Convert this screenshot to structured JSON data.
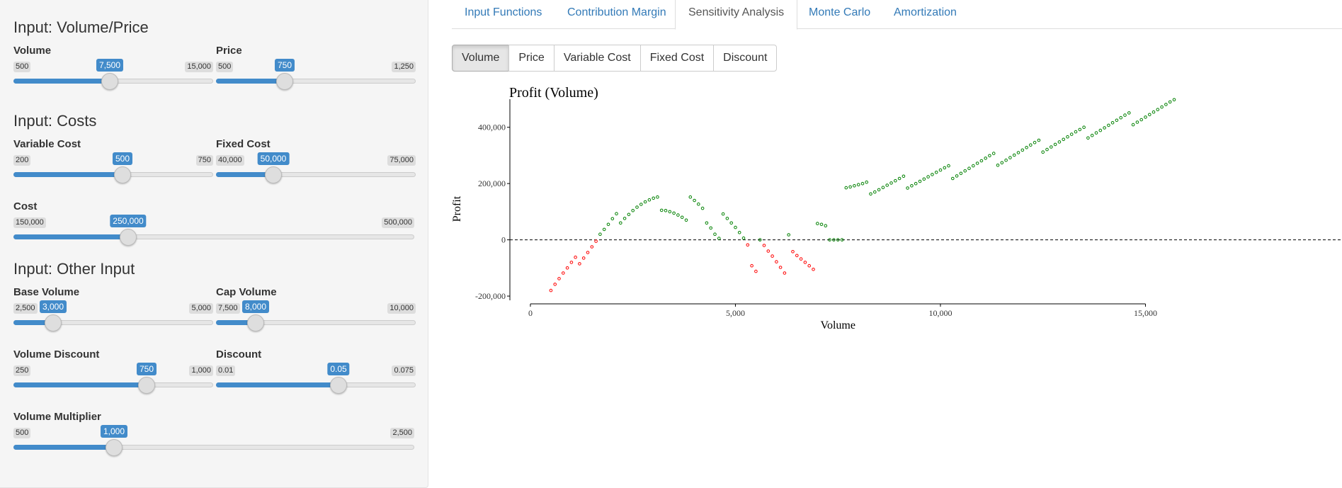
{
  "sidebar": {
    "sections": [
      {
        "title": "Input: Volume/Price"
      },
      {
        "title": "Input: Costs"
      },
      {
        "title": "Input: Other Input"
      }
    ],
    "sliders": {
      "volume": {
        "label": "Volume",
        "min": "500",
        "max": "15,000",
        "value": "7,500",
        "fraction": 0.483
      },
      "price": {
        "label": "Price",
        "min": "500",
        "max": "1,250",
        "value": "750",
        "fraction": 0.345
      },
      "variable_cost": {
        "label": "Variable Cost",
        "min": "200",
        "max": "750",
        "value": "500",
        "fraction": 0.545
      },
      "fixed_cost": {
        "label": "Fixed Cost",
        "min": "40,000",
        "max": "75,000",
        "value": "50,000",
        "fraction": 0.286
      },
      "cost": {
        "label": "Cost",
        "min": "150,000",
        "max": "500,000",
        "value": "250,000",
        "fraction": 0.286
      },
      "base_volume": {
        "label": "Base Volume",
        "min": "2,500",
        "max": "5,000",
        "value": "3,000",
        "fraction": 0.2
      },
      "cap_volume": {
        "label": "Cap Volume",
        "min": "7,500",
        "max": "10,000",
        "value": "8,000",
        "fraction": 0.2
      },
      "volume_discount": {
        "label": "Volume Discount",
        "min": "250",
        "max": "1,000",
        "value": "750",
        "fraction": 0.667
      },
      "discount": {
        "label": "Discount",
        "min": "0.01",
        "max": "0.075",
        "value": "0.05",
        "fraction": 0.615
      },
      "volume_multiplier": {
        "label": "Volume Multiplier",
        "min": "500",
        "max": "2,500",
        "value": "1,000",
        "fraction": 0.25
      }
    }
  },
  "tabs": [
    {
      "label": "Input Functions",
      "active": false
    },
    {
      "label": "Contribution Margin",
      "active": false
    },
    {
      "label": "Sensitivity Analysis",
      "active": true
    },
    {
      "label": "Monte Carlo",
      "active": false
    },
    {
      "label": "Amortization",
      "active": false
    }
  ],
  "buttons": [
    {
      "label": "Volume",
      "active": true
    },
    {
      "label": "Price",
      "active": false
    },
    {
      "label": "Variable Cost",
      "active": false
    },
    {
      "label": "Fixed Cost",
      "active": false
    },
    {
      "label": "Discount",
      "active": false
    }
  ],
  "colors": {
    "accent": "#428bca",
    "positive": "#008000",
    "negative": "#ff0000",
    "link": "#337ab7"
  },
  "chart_data": {
    "type": "scatter",
    "title": "Profit (Volume)",
    "xlabel": "Volume",
    "ylabel": "Profit",
    "xlim": [
      0,
      15000
    ],
    "ylim": [
      -200000,
      500000
    ],
    "x_ticks": [
      0,
      5000,
      10000,
      15000
    ],
    "x_tick_labels": [
      "0",
      "5,000",
      "10,000",
      "15,000"
    ],
    "y_ticks": [
      -200000,
      0,
      200000,
      400000
    ],
    "y_tick_labels": [
      "-200,000",
      "0",
      "200,000",
      "400,000"
    ],
    "reference_line": {
      "y": 0,
      "style": "dashed"
    },
    "color_rule": "green when profit >= 0, red when profit < 0",
    "series": [
      {
        "points": [
          [
            500,
            -180000
          ],
          [
            600,
            -158000
          ],
          [
            700,
            -138000
          ],
          [
            800,
            -118000
          ],
          [
            900,
            -100000
          ],
          [
            1000,
            -80000
          ],
          [
            1100,
            -62000
          ],
          [
            1200,
            -85000
          ],
          [
            1300,
            -65000
          ],
          [
            1400,
            -45000
          ],
          [
            1500,
            -25000
          ],
          [
            1600,
            -5000
          ],
          [
            1700,
            20000
          ],
          [
            1800,
            37000
          ],
          [
            1900,
            55000
          ],
          [
            2000,
            75000
          ],
          [
            2100,
            93000
          ],
          [
            2200,
            60000
          ],
          [
            2300,
            76000
          ],
          [
            2400,
            90000
          ],
          [
            2500,
            104000
          ],
          [
            2600,
            116000
          ],
          [
            2700,
            126000
          ],
          [
            2800,
            135000
          ],
          [
            2900,
            142000
          ],
          [
            3000,
            148000
          ],
          [
            3100,
            152000
          ],
          [
            3200,
            105000
          ],
          [
            3300,
            104000
          ],
          [
            3400,
            100000
          ],
          [
            3500,
            95000
          ],
          [
            3600,
            88000
          ],
          [
            3700,
            80000
          ],
          [
            3800,
            70000
          ],
          [
            3900,
            152000
          ],
          [
            4000,
            140000
          ],
          [
            4100,
            127000
          ],
          [
            4200,
            112000
          ],
          [
            4300,
            60000
          ],
          [
            4400,
            42000
          ],
          [
            4500,
            20000
          ],
          [
            4600,
            5000
          ],
          [
            4700,
            92000
          ],
          [
            4800,
            76000
          ],
          [
            4900,
            60000
          ],
          [
            5000,
            44000
          ],
          [
            5100,
            26000
          ],
          [
            5200,
            6000
          ],
          [
            5300,
            -18000
          ],
          [
            5400,
            -92000
          ],
          [
            5500,
            -112000
          ],
          [
            5600,
            0
          ],
          [
            5700,
            -20000
          ],
          [
            5800,
            -40000
          ],
          [
            5900,
            -58000
          ],
          [
            6000,
            -78000
          ],
          [
            6100,
            -98000
          ],
          [
            6200,
            -118000
          ],
          [
            6300,
            18000
          ],
          [
            6400,
            -42000
          ],
          [
            6500,
            -56000
          ],
          [
            6600,
            -68000
          ],
          [
            6700,
            -80000
          ],
          [
            6800,
            -92000
          ],
          [
            6900,
            -105000
          ],
          [
            7000,
            58000
          ],
          [
            7100,
            55000
          ],
          [
            7200,
            50000
          ],
          [
            7300,
            0
          ],
          [
            7400,
            0
          ],
          [
            7500,
            0
          ],
          [
            7600,
            0
          ],
          [
            7700,
            185000
          ],
          [
            7800,
            188000
          ],
          [
            7900,
            192000
          ],
          [
            8000,
            196000
          ],
          [
            8100,
            200000
          ],
          [
            8200,
            205000
          ],
          [
            8300,
            163000
          ],
          [
            8400,
            170000
          ],
          [
            8500,
            178000
          ],
          [
            8600,
            186000
          ],
          [
            8700,
            194000
          ],
          [
            8800,
            202000
          ],
          [
            8900,
            210000
          ],
          [
            9000,
            218000
          ],
          [
            9100,
            226000
          ],
          [
            9200,
            184000
          ],
          [
            9300,
            192000
          ],
          [
            9400,
            200000
          ],
          [
            9500,
            208000
          ],
          [
            9600,
            216000
          ],
          [
            9700,
            224000
          ],
          [
            9800,
            232000
          ],
          [
            9900,
            240000
          ],
          [
            10000,
            248000
          ],
          [
            10100,
            256000
          ],
          [
            10200,
            263000
          ],
          [
            10300,
            218000
          ],
          [
            10400,
            227000
          ],
          [
            10500,
            236000
          ],
          [
            10600,
            245000
          ],
          [
            10700,
            254000
          ],
          [
            10800,
            263000
          ],
          [
            10900,
            272000
          ],
          [
            11000,
            281000
          ],
          [
            11100,
            290000
          ],
          [
            11200,
            299000
          ],
          [
            11300,
            307000
          ],
          [
            11400,
            265000
          ],
          [
            11500,
            274000
          ],
          [
            11600,
            283000
          ],
          [
            11700,
            292000
          ],
          [
            11800,
            301000
          ],
          [
            11900,
            310000
          ],
          [
            12000,
            319000
          ],
          [
            12100,
            328000
          ],
          [
            12200,
            337000
          ],
          [
            12300,
            346000
          ],
          [
            12400,
            354000
          ],
          [
            12500,
            312000
          ],
          [
            12600,
            321000
          ],
          [
            12700,
            330000
          ],
          [
            12800,
            339000
          ],
          [
            12900,
            348000
          ],
          [
            13000,
            357000
          ],
          [
            13100,
            366000
          ],
          [
            13200,
            375000
          ],
          [
            13300,
            384000
          ],
          [
            13400,
            392000
          ],
          [
            13500,
            400000
          ],
          [
            13600,
            362000
          ],
          [
            13700,
            371000
          ],
          [
            13800,
            380000
          ],
          [
            13900,
            389000
          ],
          [
            14000,
            398000
          ],
          [
            14100,
            407000
          ],
          [
            14200,
            416000
          ],
          [
            14300,
            425000
          ],
          [
            14400,
            434000
          ],
          [
            14500,
            443000
          ],
          [
            14600,
            451000
          ],
          [
            14700,
            409000
          ],
          [
            14800,
            418000
          ],
          [
            14900,
            427000
          ],
          [
            15000,
            436000
          ],
          [
            15100,
            445000
          ],
          [
            15200,
            454000
          ],
          [
            15300,
            463000
          ],
          [
            15400,
            472000
          ],
          [
            15500,
            481000
          ],
          [
            15600,
            490000
          ],
          [
            15700,
            498000
          ]
        ]
      }
    ]
  }
}
